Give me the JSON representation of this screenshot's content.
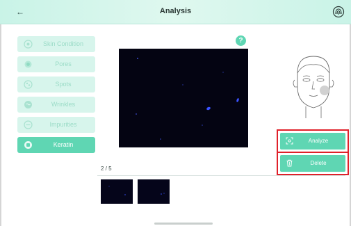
{
  "header": {
    "title": "Analysis",
    "back_icon": "back-arrow-icon",
    "right_icon": "fingerprint-scan-icon"
  },
  "sidebar": {
    "items": [
      {
        "label": "Skin Condition",
        "icon": "skin-condition-icon",
        "active": false
      },
      {
        "label": "Pores",
        "icon": "pores-icon",
        "active": false
      },
      {
        "label": "Spots",
        "icon": "spots-icon",
        "active": false
      },
      {
        "label": "Wrinkles",
        "icon": "wrinkles-icon",
        "active": false
      },
      {
        "label": "Impurities",
        "icon": "impurities-icon",
        "active": false
      },
      {
        "label": "Keratin",
        "icon": "keratin-icon",
        "active": true
      }
    ]
  },
  "main": {
    "help_label": "?",
    "page_indicator": "2 / 5"
  },
  "actions": {
    "analyze_label": "Analyze",
    "delete_label": "Delete"
  },
  "colors": {
    "accent": "#5fd6b3",
    "header_bg": "#c9f3e7",
    "inactive_item_bg": "#d7f5ec",
    "highlight_border": "#e0202a"
  }
}
